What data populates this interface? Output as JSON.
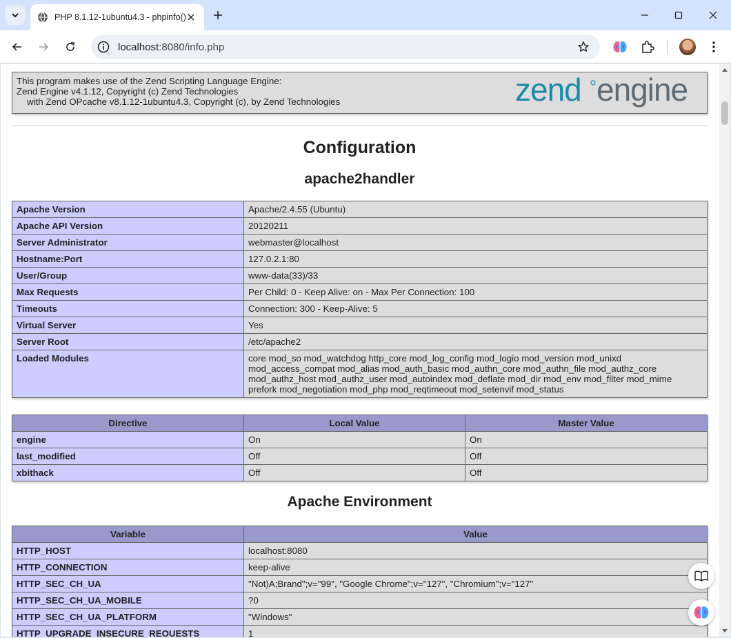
{
  "browser": {
    "tab": {
      "title": "PHP 8.1.12-1ubuntu4.3 - phpinfo()"
    },
    "address_bar": {
      "host": "localhost",
      "rest": ":8080/info.php"
    },
    "colors": {
      "tabstrip": "#d3e3fd",
      "omnibox": "#edf0f5"
    }
  },
  "page": {
    "zend": {
      "line1": "This program makes use of the Zend Scripting Language Engine:",
      "line2": "Zend Engine v4.1.12, Copyright (c) Zend Technologies",
      "line3": "with Zend OPcache v8.1.12-1ubuntu4.3, Copyright (c), by Zend Technologies",
      "logo_word1": "zend",
      "logo_word2": "engine"
    },
    "configuration_heading": "Configuration",
    "module_heading": "apache2handler",
    "apache_table": [
      {
        "key": "Apache Version",
        "value": "Apache/2.4.55 (Ubuntu)"
      },
      {
        "key": "Apache API Version",
        "value": "20120211"
      },
      {
        "key": "Server Administrator",
        "value": "webmaster@localhost"
      },
      {
        "key": "Hostname:Port",
        "value": "127.0.2.1:80"
      },
      {
        "key": "User/Group",
        "value": "www-data(33)/33"
      },
      {
        "key": "Max Requests",
        "value": "Per Child: 0 - Keep Alive: on - Max Per Connection: 100"
      },
      {
        "key": "Timeouts",
        "value": "Connection: 300 - Keep-Alive: 5"
      },
      {
        "key": "Virtual Server",
        "value": "Yes"
      },
      {
        "key": "Server Root",
        "value": "/etc/apache2"
      },
      {
        "key": "Loaded Modules",
        "value": "core mod_so mod_watchdog http_core mod_log_config mod_logio mod_version mod_unixd mod_access_compat mod_alias mod_auth_basic mod_authn_core mod_authn_file mod_authz_core mod_authz_host mod_authz_user mod_autoindex mod_deflate mod_dir mod_env mod_filter mod_mime prefork mod_negotiation mod_php mod_reqtimeout mod_setenvif mod_status"
      }
    ],
    "directive_table": {
      "headers": [
        "Directive",
        "Local Value",
        "Master Value"
      ],
      "rows": [
        [
          "engine",
          "On",
          "On"
        ],
        [
          "last_modified",
          "Off",
          "Off"
        ],
        [
          "xbithack",
          "Off",
          "Off"
        ]
      ]
    },
    "env_heading": "Apache Environment",
    "env_table": {
      "headers": [
        "Variable",
        "Value"
      ],
      "rows": [
        [
          "HTTP_HOST",
          "localhost:8080"
        ],
        [
          "HTTP_CONNECTION",
          "keep-alive"
        ],
        [
          "HTTP_SEC_CH_UA",
          "\"Not)A;Brand\";v=\"99\", \"Google Chrome\";v=\"127\", \"Chromium\";v=\"127\""
        ],
        [
          "HTTP_SEC_CH_UA_MOBILE",
          "?0"
        ],
        [
          "HTTP_SEC_CH_UA_PLATFORM",
          "\"Windows\""
        ],
        [
          "HTTP_UPGRADE_INSECURE_REQUESTS",
          "1"
        ]
      ]
    },
    "colors": {
      "key_cell": "#ccccff",
      "value_cell": "#dddddd",
      "header_cell": "#9999cc",
      "zend_blue": "#1e8aaa",
      "zend_gray": "#5f6a72"
    }
  }
}
